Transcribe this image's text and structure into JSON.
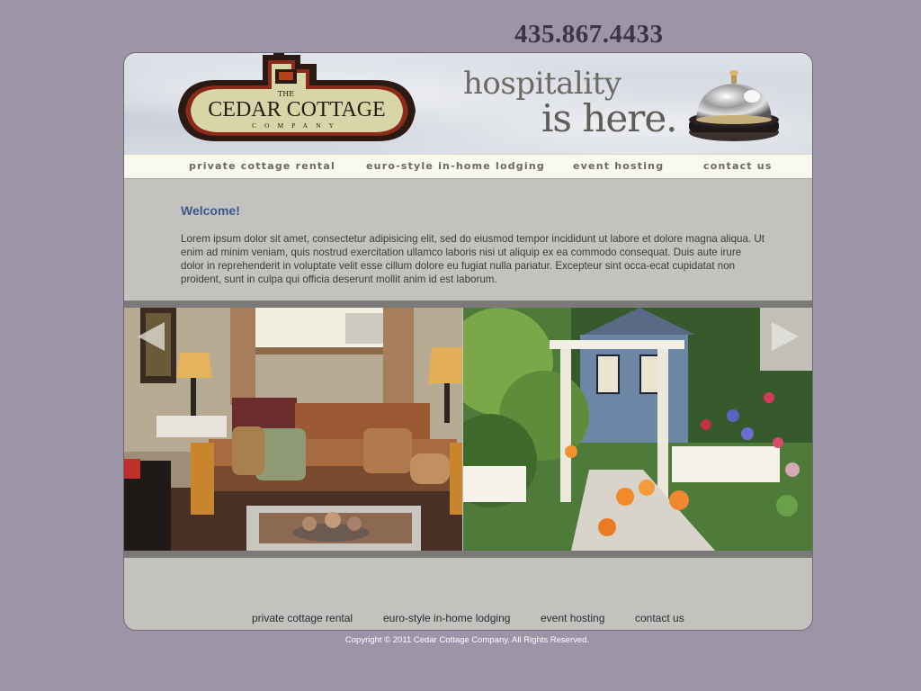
{
  "header": {
    "phone": "435.867.4433",
    "logo": {
      "the": "THE",
      "name": "CEDAR COTTAGE",
      "sub": "COMPANY"
    },
    "tagline_1": "hospitality",
    "tagline_2": "is here."
  },
  "nav": {
    "items": [
      {
        "label": "private cottage rental"
      },
      {
        "label": "euro-style in-home lodging"
      },
      {
        "label": "event hosting"
      },
      {
        "label": "contact us"
      }
    ]
  },
  "main": {
    "welcome": "Welcome!",
    "body": "Lorem ipsum dolor sit amet, consectetur adipisicing elit, sed do eiusmod tempor incididunt ut labore et dolore magna aliqua. Ut enim ad minim veniam, quis nostrud exercitation ullamco laboris nisi ut aliquip ex ea commodo consequat. Duis aute irure dolor in reprehenderit in voluptate velit esse cillum dolore eu fugiat nulla pariatur. Excepteur sint occa-ecat cupidatat non proident, sunt in culpa qui officia deserunt mollit anim id est laborum."
  },
  "gallery": {
    "prev_icon": "arrow-left-icon",
    "next_icon": "arrow-right-icon"
  },
  "footer": {
    "links": [
      {
        "label": "private cottage rental"
      },
      {
        "label": "euro-style in-home lodging"
      },
      {
        "label": "event hosting"
      },
      {
        "label": "contact us"
      }
    ],
    "copyright": "Copyright © 2011 Cedar Cottage Company.  All Rights Reserved."
  },
  "colors": {
    "page_bg": "#9b95a7",
    "content_bg": "#c3c2be",
    "accent_blue": "#3b5a8c",
    "logo_dark": "#2b1a14",
    "logo_cream": "#d8d5a8"
  }
}
